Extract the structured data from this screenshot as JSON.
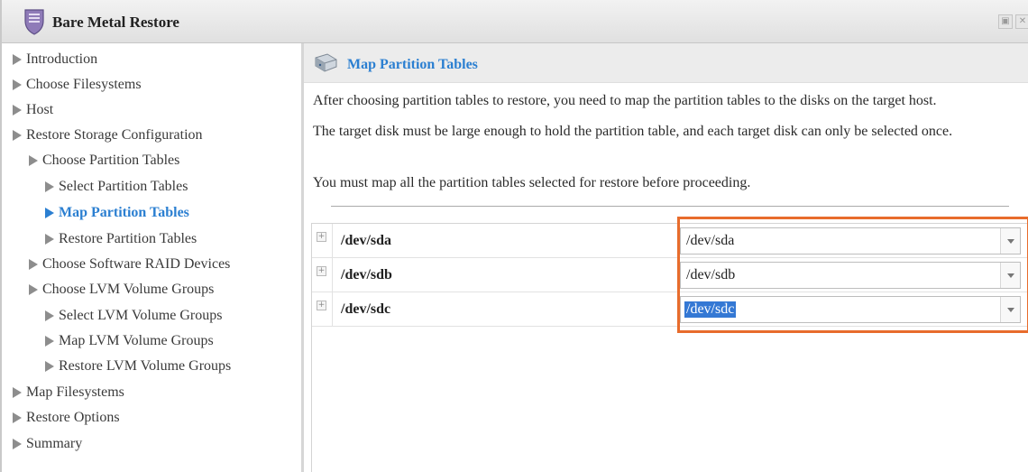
{
  "window": {
    "title": "Bare Metal Restore",
    "icon": "shield-icon",
    "controls": [
      "maximize-icon",
      "close-icon"
    ]
  },
  "sidebar": {
    "items": [
      {
        "label": "Introduction",
        "level": 0,
        "active": false
      },
      {
        "label": "Choose Filesystems",
        "level": 0,
        "active": false
      },
      {
        "label": "Host",
        "level": 0,
        "active": false
      },
      {
        "label": "Restore Storage Configuration",
        "level": 0,
        "active": false
      },
      {
        "label": "Choose Partition Tables",
        "level": 1,
        "active": false
      },
      {
        "label": "Select Partition Tables",
        "level": 2,
        "active": false
      },
      {
        "label": "Map Partition Tables",
        "level": 2,
        "active": true
      },
      {
        "label": "Restore Partition Tables",
        "level": 2,
        "active": false
      },
      {
        "label": "Choose Software RAID Devices",
        "level": 1,
        "active": false
      },
      {
        "label": "Choose LVM Volume Groups",
        "level": 1,
        "active": false
      },
      {
        "label": "Select LVM Volume Groups",
        "level": 2,
        "active": false
      },
      {
        "label": "Map LVM Volume Groups",
        "level": 2,
        "active": false
      },
      {
        "label": "Restore LVM Volume Groups",
        "level": 2,
        "active": false
      },
      {
        "label": "Map Filesystems",
        "level": 0,
        "active": false
      },
      {
        "label": "Restore Options",
        "level": 0,
        "active": false
      },
      {
        "label": "Summary",
        "level": 0,
        "active": false
      }
    ]
  },
  "main": {
    "title": "Map Partition Tables",
    "icon": "disk-drive-icon",
    "paragraphs": [
      "After choosing partition tables to restore, you need to map the partition tables to the disks on the target host.",
      "The target disk must be large enough to hold the partition table, and each target disk can only be selected once.",
      "You must map all the partition tables selected for restore before proceeding."
    ],
    "mappings": [
      {
        "source": "/dev/sda",
        "target": "/dev/sda",
        "selected": false
      },
      {
        "source": "/dev/sdb",
        "target": "/dev/sdb",
        "selected": false
      },
      {
        "source": "/dev/sdc",
        "target": "/dev/sdc",
        "selected": true
      }
    ]
  },
  "colors": {
    "accent": "#2b7fd1",
    "highlight_border": "#e86c2c",
    "selection": "#3478d4"
  }
}
